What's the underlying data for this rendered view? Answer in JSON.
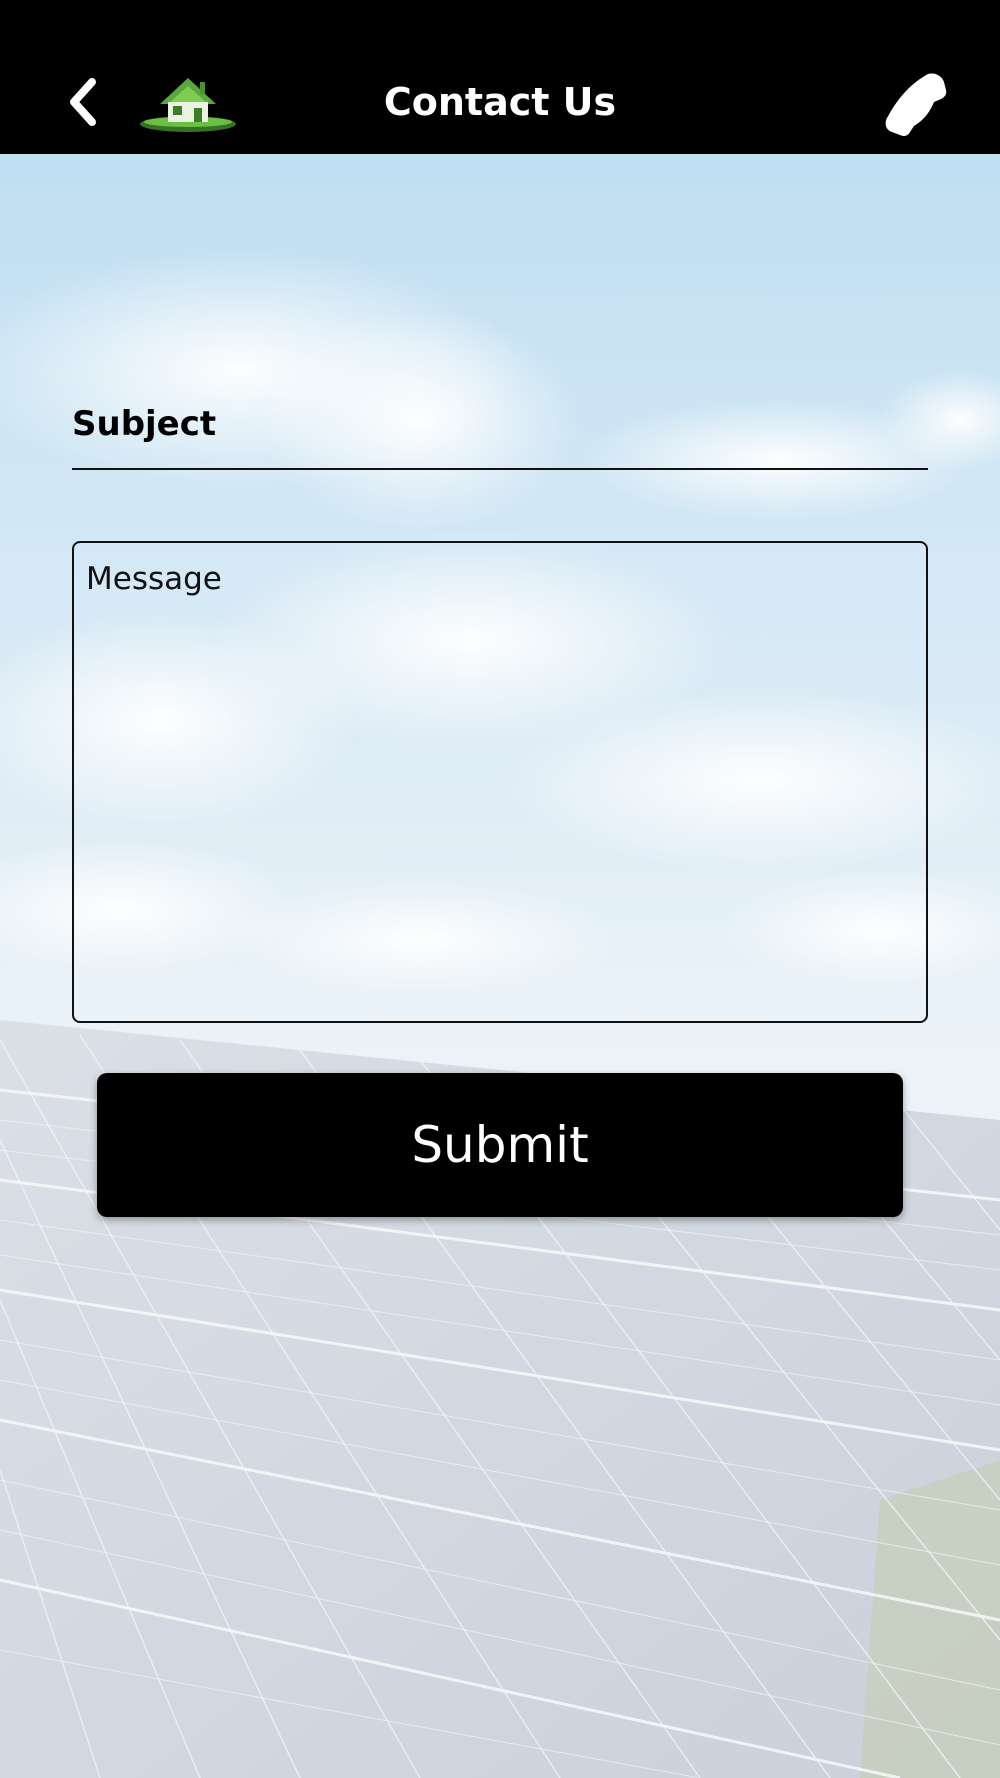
{
  "app": {
    "title": "Contact Us"
  },
  "header": {
    "back_icon": "chevron-left-icon",
    "logo_icon": "house-logo-icon",
    "call_icon": "phone-icon"
  },
  "form": {
    "subject_label": "Subject",
    "subject_value": "",
    "message_placeholder": "Message",
    "message_value": "",
    "submit_label": "Submit"
  },
  "colors": {
    "header_bg": "#000000",
    "header_text": "#ffffff",
    "button_bg": "#000000",
    "button_text": "#ffffff",
    "logo_green": "#5aa83c"
  }
}
